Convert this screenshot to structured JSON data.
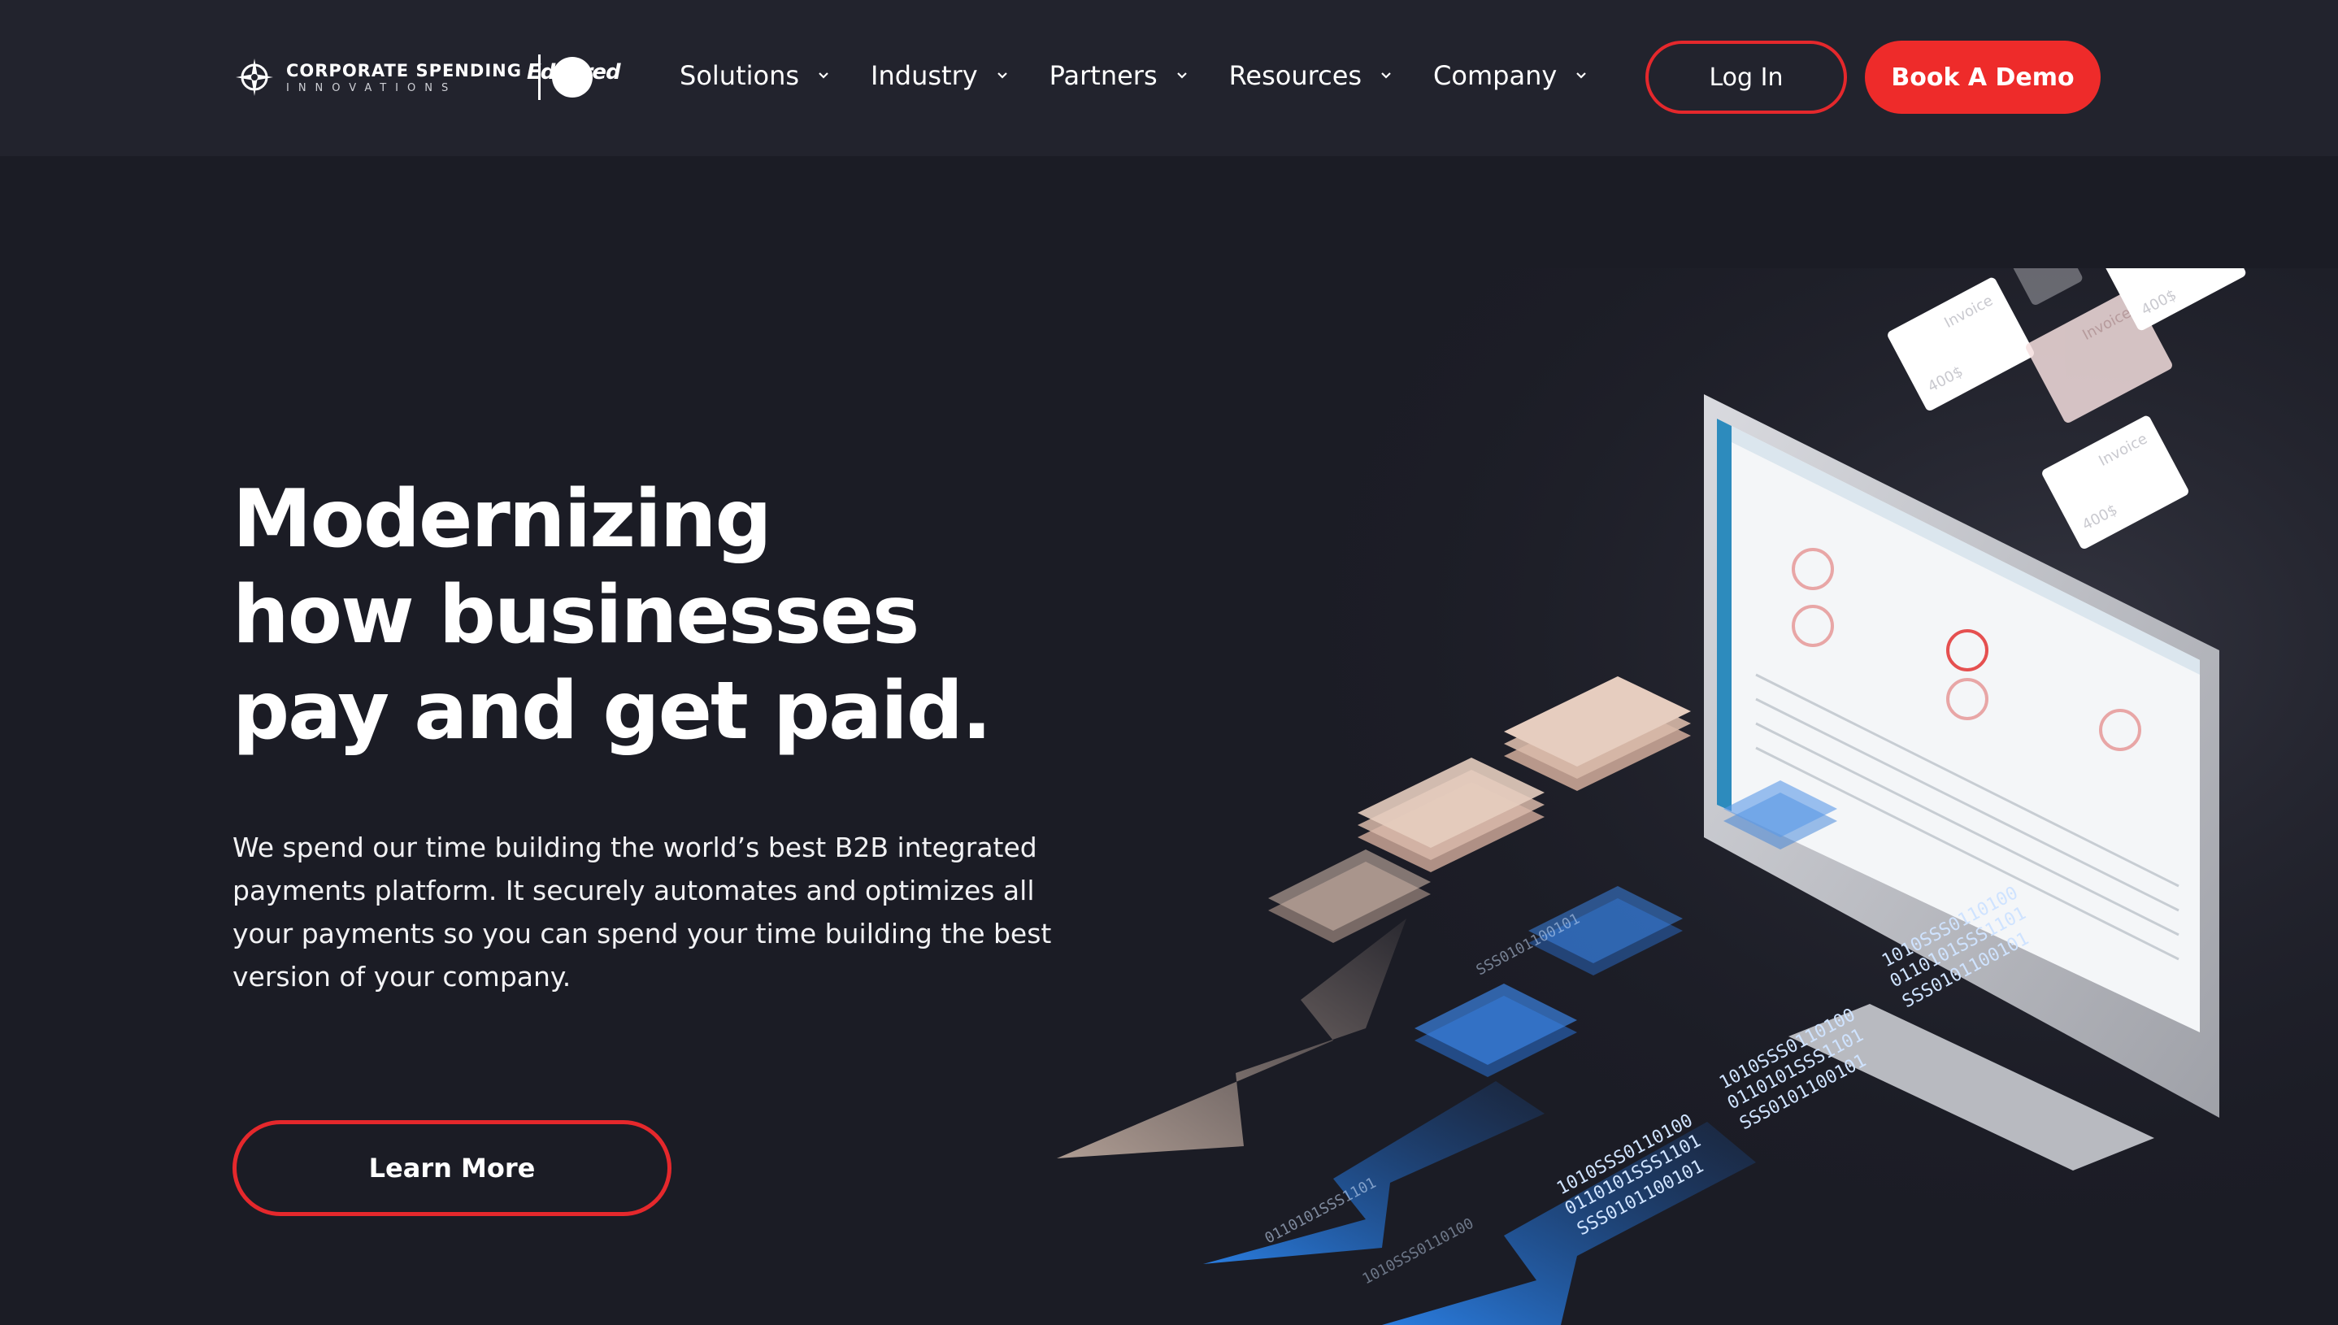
{
  "brand": {
    "name_line1": "CORPORATE SPENDING",
    "name_line2": "INNOVATIONS",
    "partner": "Edenred"
  },
  "nav": {
    "items": [
      {
        "label": "Solutions",
        "icon": "chevron-down-icon"
      },
      {
        "label": "Industry",
        "icon": "chevron-down-icon"
      },
      {
        "label": "Partners",
        "icon": "chevron-down-icon"
      },
      {
        "label": "Resources",
        "icon": "chevron-down-icon"
      },
      {
        "label": "Company",
        "icon": "chevron-down-icon"
      }
    ],
    "login_label": "Log In",
    "demo_label": "Book A Demo"
  },
  "hero": {
    "title_lines": [
      "Modernizing",
      "how businesses",
      "pay and get paid."
    ],
    "body": "We spend our time building the world’s best B2B integrated payments platform. It securely automates and optimizes all your payments so you can spend your time building the best version of your company.",
    "cta_label": "Learn More"
  },
  "illustration": {
    "invoice_label": "Invoice",
    "invoice_amount": "400$",
    "binary_a": "1010SSS0110100",
    "binary_b": "0110101SSS1101",
    "binary_c": "SSS0101100101"
  },
  "colors": {
    "background": "#1b1c25",
    "topbar": "#22232d",
    "accent_red": "#ee2b2a",
    "arrow_blue": "#2a7de0",
    "arrow_beige": "#c9b3a6"
  }
}
